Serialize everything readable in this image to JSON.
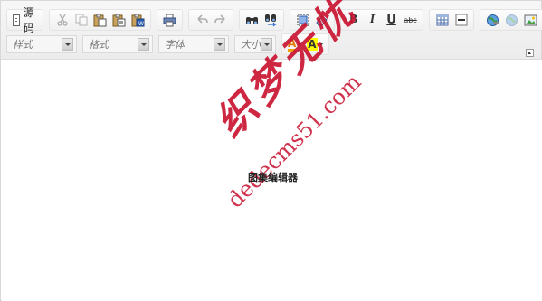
{
  "editor": {
    "source_label": "源码",
    "style_combo": "样式",
    "format_combo": "格式",
    "font_combo": "字体",
    "size_combo": "大小",
    "bold_label": "B",
    "italic_label": "I",
    "underline_label": "U",
    "strike_label": "abc",
    "text_color_label": "A",
    "bg_color_label": "A",
    "center_text": "图集编辑器"
  },
  "watermark": {
    "logo_text": "织梦无忧",
    "url": "dedecms51.com"
  },
  "icons": [
    "cut-icon",
    "copy-icon",
    "paste-icon",
    "paste-text-icon",
    "paste-word-icon",
    "print-icon",
    "undo-icon",
    "redo-icon",
    "find-icon",
    "replace-icon",
    "select-all-icon",
    "remove-format-icon",
    "table-icon",
    "horizontal-rule-icon",
    "link-icon",
    "unlink-icon",
    "image-icon",
    "anchor-flag-icon",
    "collapse-toolbar-icon"
  ],
  "colors": {
    "watermark": "#c8102e",
    "highlight": "#ffff00",
    "text_color_bar": "#f0a000"
  }
}
